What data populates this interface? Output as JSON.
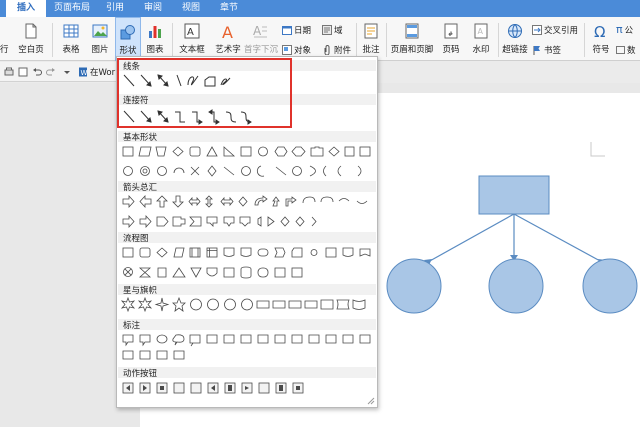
{
  "menubar": {
    "tabs": [
      {
        "label": "插入",
        "active": true
      },
      {
        "label": "页面布局"
      },
      {
        "label": "引用"
      },
      {
        "label": "审阅"
      },
      {
        "label": "视图"
      },
      {
        "label": "章节"
      }
    ]
  },
  "ribbon": {
    "partial_left": "行",
    "blank_page": "空白页",
    "table": "表格",
    "picture": "图片",
    "shape": "形状",
    "chart": "图表",
    "textbox": "文本框",
    "wordart": "艺术字",
    "dropcap": "首字下沉",
    "date": "日期",
    "field": "域",
    "object": "对象",
    "attachment": "附件",
    "comment": "批注",
    "header_footer": "页眉和页脚",
    "page_number": "页码",
    "watermark": "水印",
    "hyperlink": "超链接",
    "crossref": "交叉引用",
    "bookmark": "书签",
    "symbol": "符号",
    "formula": "公",
    "number": "数"
  },
  "toolbar2": {
    "doc_tab_label": "在Wor"
  },
  "shapes_menu": {
    "categories": [
      {
        "title": "线条"
      },
      {
        "title": "连接符"
      },
      {
        "title": "基本形状"
      },
      {
        "title": "箭头总汇"
      },
      {
        "title": "流程图"
      },
      {
        "title": "星与旗帜"
      },
      {
        "title": "标注"
      },
      {
        "title": "动作按钮"
      }
    ]
  },
  "colors": {
    "accent": "#4b8bd8",
    "highlight": "#e0322b",
    "shape_fill": "#a9c6e6",
    "shape_stroke": "#5b8cc2"
  }
}
